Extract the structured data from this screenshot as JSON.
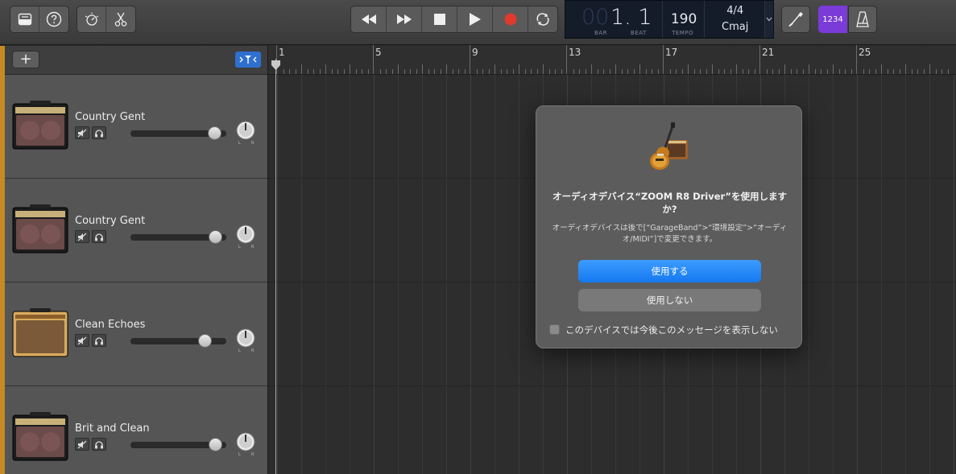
{
  "toolbar": {
    "left_buttons": [
      "library-icon",
      "help-icon",
      "smart-controls-icon",
      "scissors-icon"
    ],
    "transport": [
      "rewind-icon",
      "fast-forward-icon",
      "stop-icon",
      "play-icon",
      "record-icon",
      "cycle-icon"
    ],
    "lcd": {
      "bar_dim": "00",
      "position": "1. 1",
      "bar_label": "BAR",
      "beat_label": "BEAT",
      "tempo": "190",
      "tempo_label": "TEMPO",
      "time_signature": "4/4",
      "key": "Cmaj"
    },
    "count_in": "1234",
    "right_buttons": [
      "tuner-icon",
      "count-in-icon",
      "metronome-icon"
    ],
    "colors": {
      "count_in_active": "#7b3bd8",
      "record": "#e03a2e",
      "lcd_bg": "#141b29"
    }
  },
  "track_header": {
    "add_label": "+",
    "filter_icon": "catch-playhead-icon"
  },
  "tracks": [
    {
      "name": "Country Gent",
      "amp": "black-amp",
      "volume": 0.88
    },
    {
      "name": "Country Gent",
      "amp": "black-amp",
      "volume": 0.89
    },
    {
      "name": "Clean Echoes",
      "amp": "tweed-amp",
      "volume": 0.78
    },
    {
      "name": "Brit and Clean",
      "amp": "black-amp",
      "volume": 0.89
    }
  ],
  "track_controls": {
    "pan_left": "L",
    "pan_right": "R",
    "mute_icon": "mute-icon",
    "headphones_icon": "headphones-icon"
  },
  "ruler": {
    "bar_numbers": [
      "1",
      "5",
      "9",
      "13",
      "17",
      "21",
      "25"
    ]
  },
  "dialog": {
    "icon": "garageband-icon",
    "title": "オーディオデバイス“ZOOM R8 Driver”を使用しますか?",
    "body": "オーディオデバイスは後で[“GarageBand”>“環境設定”>“オーディオ/MIDI”]で変更できます。",
    "primary_button": "使用する",
    "secondary_button": "使用しない",
    "checkbox_label": "このデバイスでは今後このメッセージを表示しない",
    "checkbox_checked": false,
    "colors": {
      "primary": "#1f84f7"
    }
  }
}
